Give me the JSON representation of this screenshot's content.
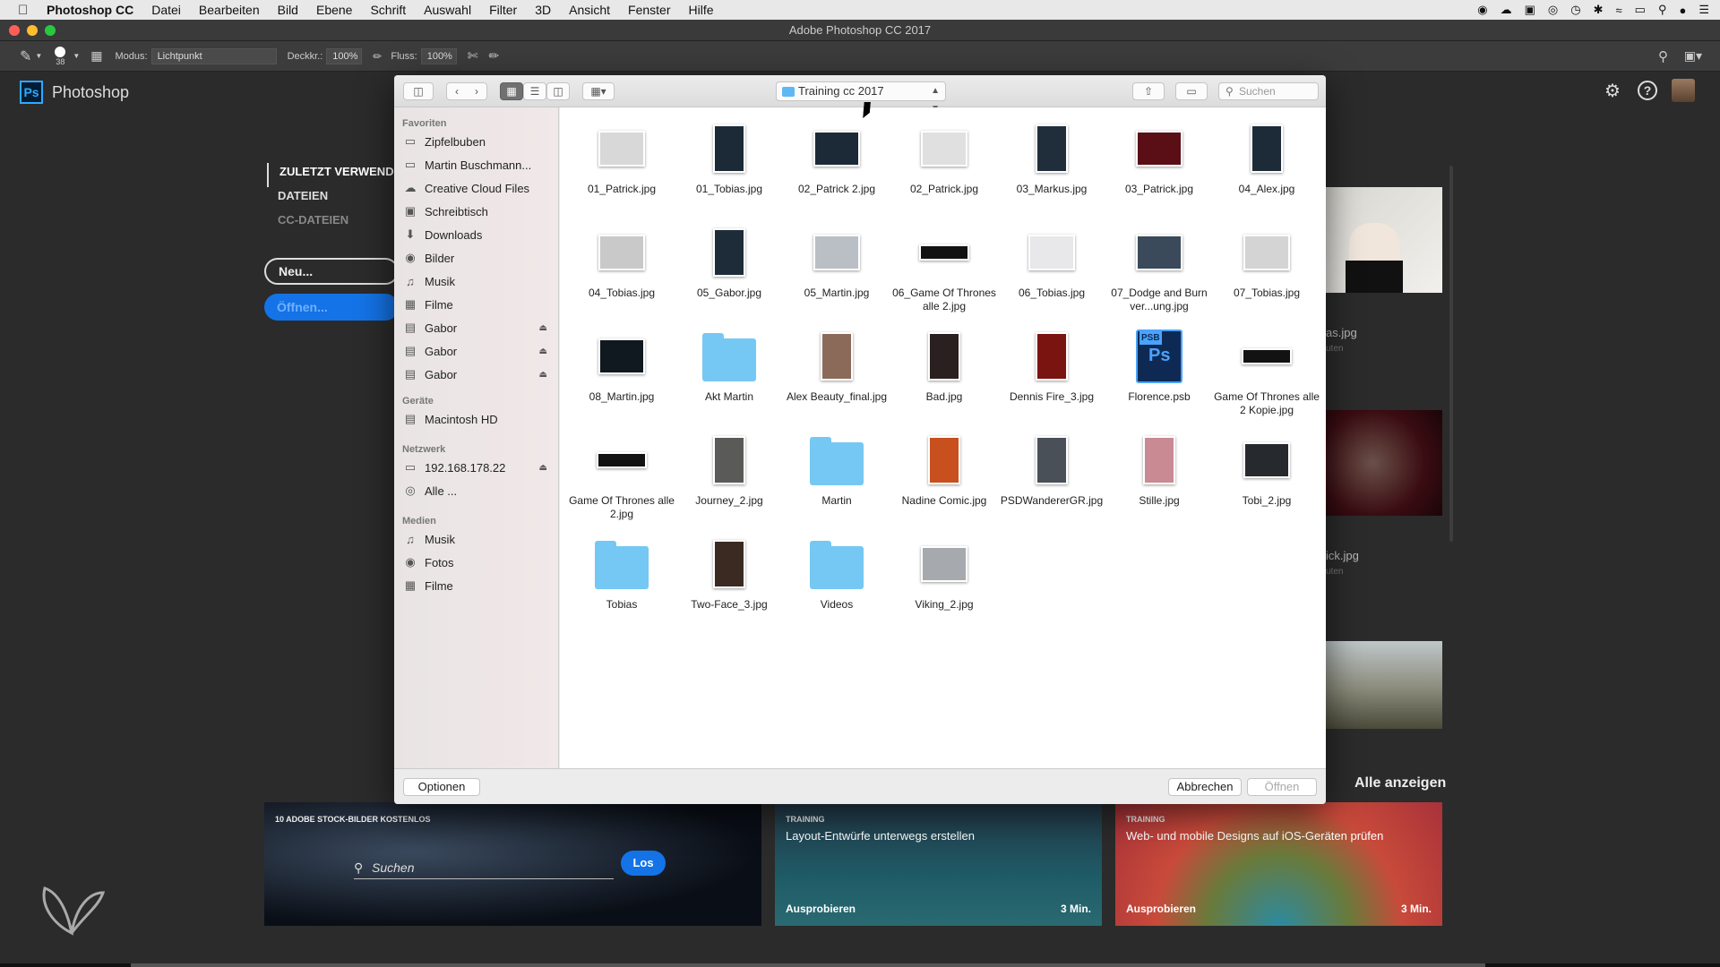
{
  "menubar": {
    "app": "Photoshop CC",
    "items": [
      "Datei",
      "Bearbeiten",
      "Bild",
      "Ebene",
      "Schrift",
      "Auswahl",
      "Filter",
      "3D",
      "Ansicht",
      "Fenster",
      "Hilfe"
    ]
  },
  "window": {
    "title": "Adobe Photoshop CC 2017"
  },
  "options": {
    "brush_size": "38",
    "mode_label": "Modus:",
    "mode_value": "Lichtpunkt",
    "opacity_label": "Deckkr.:",
    "opacity_value": "100%",
    "flow_label": "Fluss:",
    "flow_value": "100%"
  },
  "ps": {
    "logo": "Ps",
    "name": "Photoshop",
    "nav": [
      "ZULETZT VERWENDET",
      "DATEIEN",
      "CC-DATEIEN"
    ],
    "new_button": "Neu...",
    "open_button": "Öffnen...",
    "recent": [
      {
        "label": "as.jpg",
        "sub": "uten"
      },
      {
        "label": "ick.jpg",
        "sub": "uten"
      }
    ],
    "show_all": "Alle anzeigen",
    "cards": [
      {
        "tag": "10 ADOBE STOCK-BILDER KOSTENLOS",
        "search": "Suchen",
        "go": "Los"
      },
      {
        "tag": "TRAINING",
        "title": "Layout-Entwürfe unterwegs erstellen",
        "cta": "Ausprobieren",
        "duration": "3 Min."
      },
      {
        "tag": "TRAINING",
        "title": "Web- und mobile Designs auf iOS-Geräten prüfen",
        "cta": "Ausprobieren",
        "duration": "3 Min."
      }
    ]
  },
  "dialog": {
    "location": "Training cc 2017",
    "search_placeholder": "Suchen",
    "sidebar": {
      "favorites_head": "Favoriten",
      "favorites": [
        "Zipfelbuben",
        "Martin Buschmann...",
        "Creative Cloud Files",
        "Schreibtisch",
        "Downloads",
        "Bilder",
        "Musik",
        "Filme",
        "Gabor",
        "Gabor",
        "Gabor"
      ],
      "devices_head": "Geräte",
      "devices": [
        "Macintosh HD"
      ],
      "network_head": "Netzwerk",
      "network": [
        "192.168.178.22",
        "Alle ..."
      ],
      "media_head": "Medien",
      "media": [
        "Musik",
        "Fotos",
        "Filme"
      ]
    },
    "files": [
      {
        "name": "01_Patrick.jpg",
        "kind": "photo",
        "color": "#d8d8d8"
      },
      {
        "name": "01_Tobias.jpg",
        "kind": "photo",
        "color": "#1b2a36"
      },
      {
        "name": "02_Patrick 2.jpg",
        "kind": "photo",
        "color": "#1b2a36"
      },
      {
        "name": "02_Patrick.jpg",
        "kind": "photo",
        "color": "#e0e0e0"
      },
      {
        "name": "03_Markus.jpg",
        "kind": "photo",
        "color": "#1f2e3a"
      },
      {
        "name": "03_Patrick.jpg",
        "kind": "photo",
        "color": "#5a0f17"
      },
      {
        "name": "04_Alex.jpg",
        "kind": "photo",
        "color": "#1c2b37"
      },
      {
        "name": "04_Tobias.jpg",
        "kind": "photo",
        "color": "#c9c9c9"
      },
      {
        "name": "05_Gabor.jpg",
        "kind": "photo",
        "color": "#1d2c38"
      },
      {
        "name": "05_Martin.jpg",
        "kind": "photo",
        "color": "#b9bfc4"
      },
      {
        "name": "06_Game Of Thrones alle 2.jpg",
        "kind": "photo",
        "color": "#121212"
      },
      {
        "name": "06_Tobias.jpg",
        "kind": "photo",
        "color": "#e8e8ea"
      },
      {
        "name": "07_Dodge and Burn ver...ung.jpg",
        "kind": "photo",
        "color": "#3a4a5a"
      },
      {
        "name": "07_Tobias.jpg",
        "kind": "photo",
        "color": "#d4d4d4"
      },
      {
        "name": "08_Martin.jpg",
        "kind": "photo",
        "color": "#101820"
      },
      {
        "name": "Akt Martin",
        "kind": "folder"
      },
      {
        "name": "Alex Beauty_final.jpg",
        "kind": "photo",
        "color": "#8b6a5a"
      },
      {
        "name": "Bad.jpg",
        "kind": "photo",
        "color": "#2a2020"
      },
      {
        "name": "Dennis Fire_3.jpg",
        "kind": "photo",
        "color": "#7a1410"
      },
      {
        "name": "Florence.psb",
        "kind": "psb"
      },
      {
        "name": "Game Of Thrones alle 2 Kopie.jpg",
        "kind": "photo",
        "color": "#121212"
      },
      {
        "name": "Game Of Thrones alle 2.jpg",
        "kind": "photo",
        "color": "#121212"
      },
      {
        "name": "Journey_2.jpg",
        "kind": "photo",
        "color": "#5a5a58"
      },
      {
        "name": "Martin",
        "kind": "folder"
      },
      {
        "name": "Nadine Comic.jpg",
        "kind": "photo",
        "color": "#c8501e"
      },
      {
        "name": "PSDWandererGR.jpg",
        "kind": "photo",
        "color": "#4a5058"
      },
      {
        "name": "Stille.jpg",
        "kind": "photo",
        "color": "#c98a94"
      },
      {
        "name": "Tobi_2.jpg",
        "kind": "photo",
        "color": "#262a2e"
      },
      {
        "name": "Tobias",
        "kind": "folder"
      },
      {
        "name": "Two-Face_3.jpg",
        "kind": "photo",
        "color": "#3a2a22"
      },
      {
        "name": "Videos",
        "kind": "folder"
      },
      {
        "name": "Viking_2.jpg",
        "kind": "photo",
        "color": "#a6a9ad"
      }
    ],
    "options_button": "Optionen",
    "cancel_button": "Abbrechen",
    "open_button": "Öffnen"
  }
}
